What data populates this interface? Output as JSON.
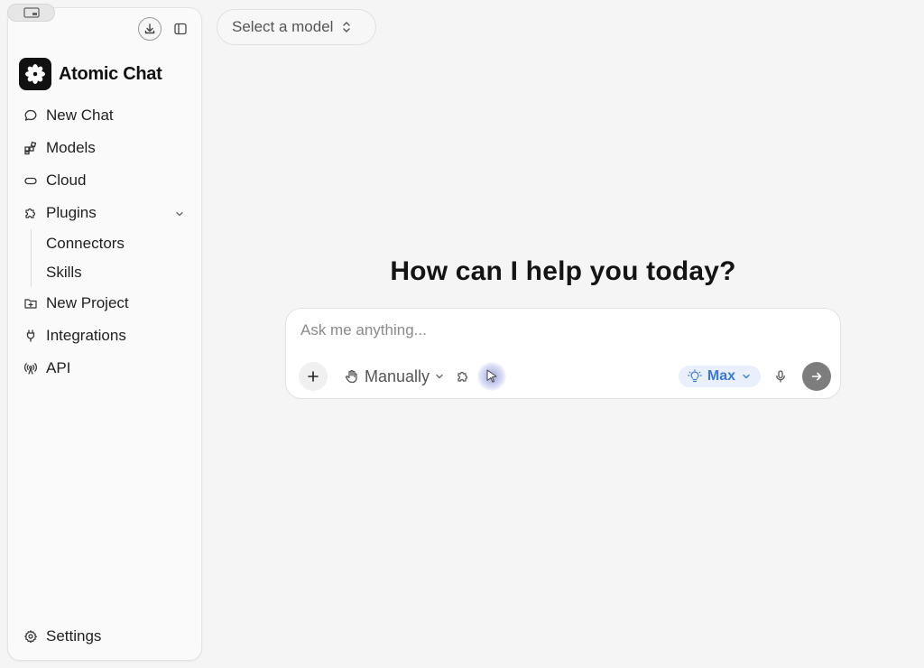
{
  "app": {
    "brand_name": "Atomic Chat"
  },
  "sidebar": {
    "items": [
      {
        "label": "New Chat",
        "icon": "chat-bubble-icon"
      },
      {
        "label": "Models",
        "icon": "grid-icon"
      },
      {
        "label": "Cloud",
        "icon": "cloud-icon"
      },
      {
        "label": "Plugins",
        "icon": "puzzle-icon",
        "expanded": true
      }
    ],
    "plugins_children": [
      "Connectors",
      "Skills"
    ],
    "items_after": [
      {
        "label": "New Project",
        "icon": "folder-plus-icon"
      },
      {
        "label": "Integrations",
        "icon": "plug-icon"
      },
      {
        "label": "API",
        "icon": "antenna-icon"
      }
    ],
    "settings_label": "Settings"
  },
  "header": {
    "model_select_label": "Select a model"
  },
  "main": {
    "greeting": "How can I help you today?"
  },
  "composer": {
    "placeholder": "Ask me anything...",
    "mode_label": "Manually",
    "effort_label": "Max"
  },
  "colors": {
    "accent": "#3b78d8",
    "send_button": "#7d7d7d",
    "logo_bg": "#111111"
  }
}
